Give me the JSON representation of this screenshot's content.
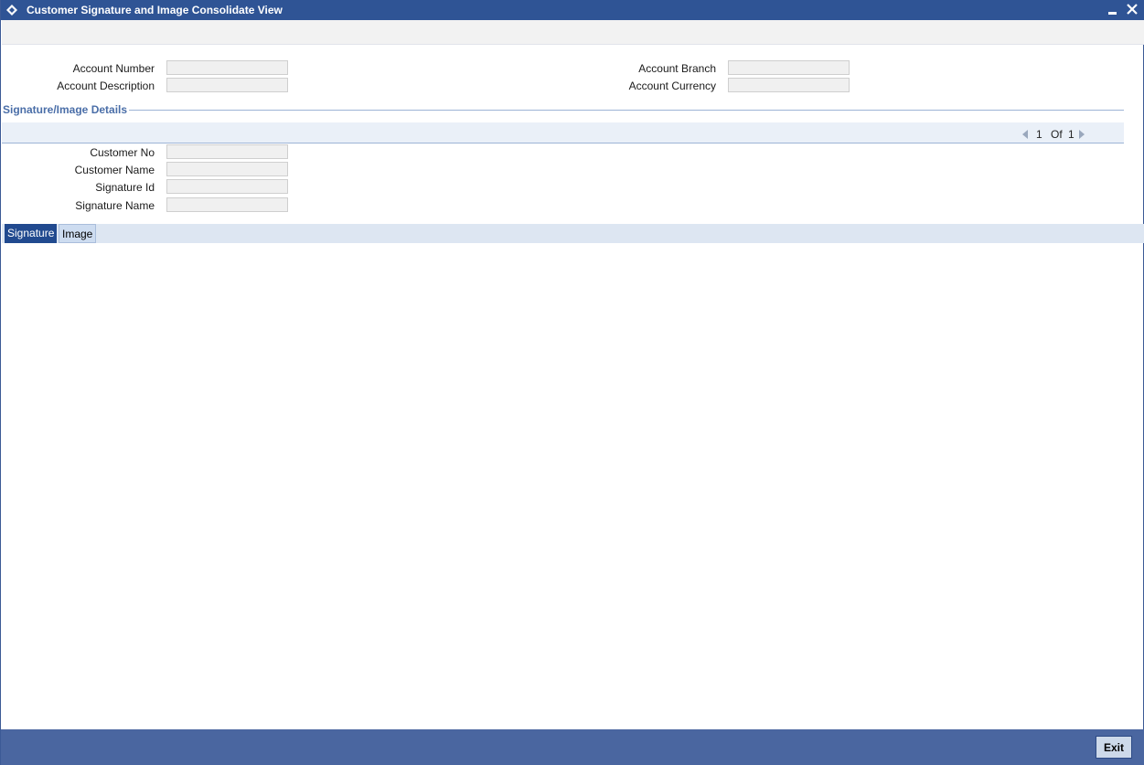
{
  "window": {
    "title": "Customer Signature and Image Consolidate View",
    "icon": "diamond-icon",
    "controls": [
      "minimize-icon",
      "close-icon"
    ]
  },
  "account": {
    "number_label": "Account Number",
    "number_value": "",
    "description_label": "Account Description",
    "description_value": "",
    "branch_label": "Account Branch",
    "branch_value": "",
    "currency_label": "Account Currency",
    "currency_value": ""
  },
  "details": {
    "section_title": "Signature/Image Details",
    "pager": {
      "current": "1",
      "of_label": "Of",
      "total": "1"
    },
    "customer_no_label": "Customer No",
    "customer_no_value": "",
    "customer_name_label": "Customer Name",
    "customer_name_value": "",
    "signature_id_label": "Signature Id",
    "signature_id_value": "",
    "signature_name_label": "Signature Name",
    "signature_name_value": ""
  },
  "tabs": [
    {
      "label": "Signature",
      "active": true
    },
    {
      "label": "Image",
      "active": false
    }
  ],
  "footer": {
    "exit_label": "Exit"
  },
  "colors": {
    "titlebar": "#2f5495",
    "section_title": "#4a6ea8",
    "active_tab": "#214a8f",
    "footer": "#4a66a0"
  }
}
